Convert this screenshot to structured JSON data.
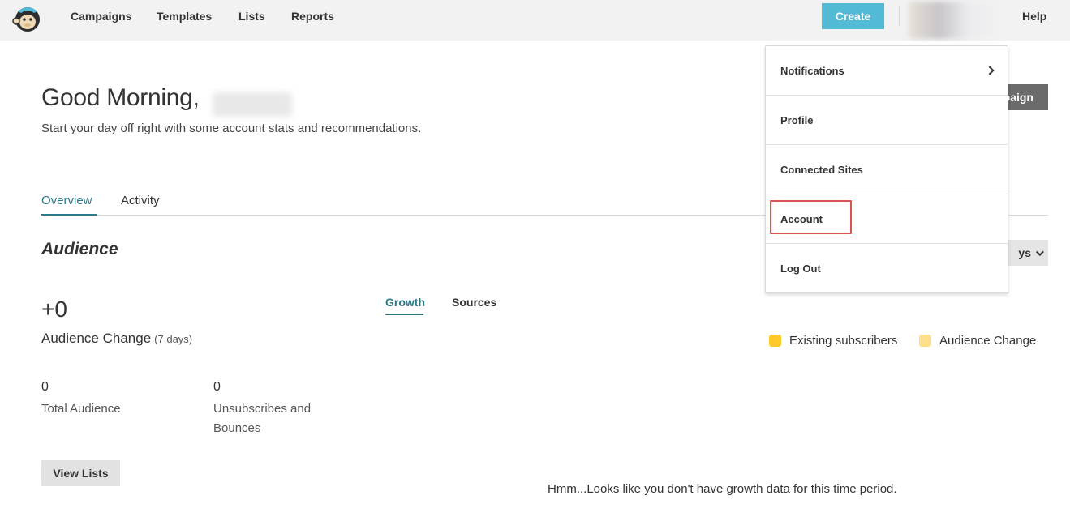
{
  "nav": {
    "logo_icon": "mailchimp-monkey-icon",
    "links": [
      "Campaigns",
      "Templates",
      "Lists",
      "Reports"
    ],
    "create_label": "Create",
    "help_label": "Help"
  },
  "header": {
    "greeting": "Good Morning,",
    "subtitle": "Start your day off right with some account stats and recommendations.",
    "campaign_button_partial": "paign"
  },
  "tabs": [
    "Overview",
    "Activity"
  ],
  "audience": {
    "title": "Audience",
    "change_value": "+0",
    "change_label": "Audience Change",
    "change_period": "(7 days)",
    "period_partial": "ys",
    "total_value": "0",
    "total_label": "Total Audience",
    "unsub_value": "0",
    "unsub_label_line1": "Unsubscribes and",
    "unsub_label_line2": "Bounces",
    "view_lists_label": "View Lists",
    "subtabs": [
      "Growth",
      "Sources"
    ],
    "legend": [
      {
        "label": "Existing subscribers",
        "color": "#ffc928"
      },
      {
        "label": "Audience Change",
        "color": "#ffe08a"
      }
    ],
    "empty_message": "Hmm...Looks like you don't have growth data for this time period."
  },
  "menu": {
    "items": [
      "Notifications",
      "Profile",
      "Connected Sites",
      "Account",
      "Log Out"
    ],
    "highlight_color": "#d9534f"
  },
  "colors": {
    "accent": "#2b7a8a",
    "create": "#52bad5"
  }
}
